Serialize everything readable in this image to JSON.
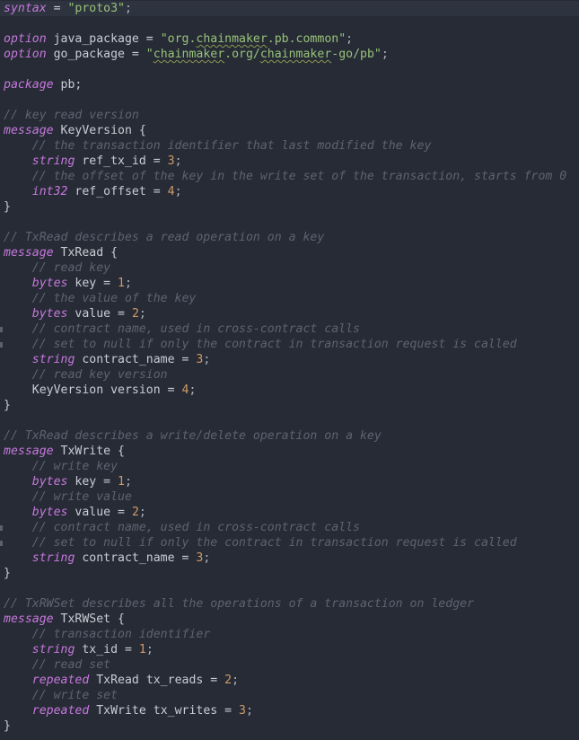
{
  "editor": {
    "language": "proto3",
    "lines": [
      {
        "y": 0,
        "tokens": [
          [
            "kw",
            "syntax"
          ],
          [
            "id",
            " = "
          ],
          [
            "str",
            "\"proto3\""
          ],
          [
            "punc",
            ";"
          ]
        ]
      },
      {
        "y": 1,
        "tokens": []
      },
      {
        "y": 2,
        "tokens": [
          [
            "kw",
            "option"
          ],
          [
            "id",
            " java_package = "
          ],
          [
            "str",
            "\"org."
          ],
          [
            "strw",
            "chainmaker"
          ],
          [
            "str",
            ".pb.common\""
          ],
          [
            "punc",
            ";"
          ]
        ]
      },
      {
        "y": 3,
        "tokens": [
          [
            "kw",
            "option"
          ],
          [
            "id",
            " go_package = "
          ],
          [
            "str",
            "\""
          ],
          [
            "strw",
            "chainmaker"
          ],
          [
            "str",
            ".org/"
          ],
          [
            "strw",
            "chainmaker"
          ],
          [
            "str",
            "-go/pb\""
          ],
          [
            "punc",
            ";"
          ]
        ]
      },
      {
        "y": 4,
        "tokens": []
      },
      {
        "y": 5,
        "tokens": [
          [
            "kw",
            "package"
          ],
          [
            "id",
            " pb;"
          ]
        ]
      },
      {
        "y": 6,
        "tokens": []
      },
      {
        "y": 7,
        "tokens": [
          [
            "cm",
            "// key read version"
          ]
        ]
      },
      {
        "y": 8,
        "tokens": [
          [
            "kw",
            "message"
          ],
          [
            "id",
            " KeyVersion {"
          ]
        ]
      },
      {
        "y": 9,
        "tokens": [
          [
            "id",
            "    "
          ],
          [
            "cm",
            "// the transaction identifier that last modified the key"
          ]
        ]
      },
      {
        "y": 10,
        "tokens": [
          [
            "id",
            "    "
          ],
          [
            "type",
            "string"
          ],
          [
            "id",
            " ref_tx_id = "
          ],
          [
            "num",
            "3"
          ],
          [
            "punc",
            ";"
          ]
        ]
      },
      {
        "y": 11,
        "tokens": [
          [
            "id",
            "    "
          ],
          [
            "cm",
            "// the offset of the key in the write set of the transaction, starts from 0"
          ]
        ]
      },
      {
        "y": 12,
        "tokens": [
          [
            "id",
            "    "
          ],
          [
            "type",
            "int32"
          ],
          [
            "id",
            " ref_offset = "
          ],
          [
            "num",
            "4"
          ],
          [
            "punc",
            ";"
          ]
        ]
      },
      {
        "y": 13,
        "tokens": [
          [
            "id",
            "}"
          ]
        ]
      },
      {
        "y": 14,
        "tokens": []
      },
      {
        "y": 15,
        "tokens": [
          [
            "cm",
            "// TxRead describes a read operation on a key"
          ]
        ]
      },
      {
        "y": 16,
        "tokens": [
          [
            "kw",
            "message"
          ],
          [
            "id",
            " TxRead {"
          ]
        ]
      },
      {
        "y": 17,
        "tokens": [
          [
            "id",
            "    "
          ],
          [
            "cm",
            "// read key"
          ]
        ]
      },
      {
        "y": 18,
        "tokens": [
          [
            "id",
            "    "
          ],
          [
            "type",
            "bytes"
          ],
          [
            "id",
            " key = "
          ],
          [
            "num",
            "1"
          ],
          [
            "punc",
            ";"
          ]
        ]
      },
      {
        "y": 19,
        "tokens": [
          [
            "id",
            "    "
          ],
          [
            "cm",
            "// the value of the key"
          ]
        ]
      },
      {
        "y": 20,
        "tokens": [
          [
            "id",
            "    "
          ],
          [
            "type",
            "bytes"
          ],
          [
            "id",
            " value = "
          ],
          [
            "num",
            "2"
          ],
          [
            "punc",
            ";"
          ]
        ]
      },
      {
        "y": 21,
        "tokens": [
          [
            "id",
            "    "
          ],
          [
            "cm",
            "// contract name, used in cross-contract calls"
          ]
        ],
        "mark": true
      },
      {
        "y": 22,
        "tokens": [
          [
            "id",
            "    "
          ],
          [
            "cm",
            "// set to null if only the contract in transaction request is called"
          ]
        ],
        "mark": true
      },
      {
        "y": 23,
        "tokens": [
          [
            "id",
            "    "
          ],
          [
            "type",
            "string"
          ],
          [
            "id",
            " contract_name = "
          ],
          [
            "num",
            "3"
          ],
          [
            "punc",
            ";"
          ]
        ]
      },
      {
        "y": 24,
        "tokens": [
          [
            "id",
            "    "
          ],
          [
            "cm",
            "// read key version"
          ]
        ]
      },
      {
        "y": 25,
        "tokens": [
          [
            "id",
            "    KeyVersion version = "
          ],
          [
            "num",
            "4"
          ],
          [
            "punc",
            ";"
          ]
        ]
      },
      {
        "y": 26,
        "tokens": [
          [
            "id",
            "}"
          ]
        ]
      },
      {
        "y": 27,
        "tokens": []
      },
      {
        "y": 28,
        "tokens": [
          [
            "cm",
            "// TxRead describes a write/delete operation on a key"
          ]
        ]
      },
      {
        "y": 29,
        "tokens": [
          [
            "kw",
            "message"
          ],
          [
            "id",
            " TxWrite {"
          ]
        ]
      },
      {
        "y": 30,
        "tokens": [
          [
            "id",
            "    "
          ],
          [
            "cm",
            "// write key"
          ]
        ]
      },
      {
        "y": 31,
        "tokens": [
          [
            "id",
            "    "
          ],
          [
            "type",
            "bytes"
          ],
          [
            "id",
            " key = "
          ],
          [
            "num",
            "1"
          ],
          [
            "punc",
            ";"
          ]
        ]
      },
      {
        "y": 32,
        "tokens": [
          [
            "id",
            "    "
          ],
          [
            "cm",
            "// write value"
          ]
        ]
      },
      {
        "y": 33,
        "tokens": [
          [
            "id",
            "    "
          ],
          [
            "type",
            "bytes"
          ],
          [
            "id",
            " value = "
          ],
          [
            "num",
            "2"
          ],
          [
            "punc",
            ";"
          ]
        ]
      },
      {
        "y": 34,
        "tokens": [
          [
            "id",
            "    "
          ],
          [
            "cm",
            "// contract name, used in cross-contract calls"
          ]
        ],
        "mark": true
      },
      {
        "y": 35,
        "tokens": [
          [
            "id",
            "    "
          ],
          [
            "cm",
            "// set to null if only the contract in transaction request is called"
          ]
        ],
        "mark": true
      },
      {
        "y": 36,
        "tokens": [
          [
            "id",
            "    "
          ],
          [
            "type",
            "string"
          ],
          [
            "id",
            " contract_name = "
          ],
          [
            "num",
            "3"
          ],
          [
            "punc",
            ";"
          ]
        ]
      },
      {
        "y": 37,
        "tokens": [
          [
            "id",
            "}"
          ]
        ]
      },
      {
        "y": 38,
        "tokens": []
      },
      {
        "y": 39,
        "tokens": [
          [
            "cm",
            "// TxRWSet describes all the operations of a transaction on ledger"
          ]
        ]
      },
      {
        "y": 40,
        "tokens": [
          [
            "kw",
            "message"
          ],
          [
            "id",
            " TxRWSet {"
          ]
        ]
      },
      {
        "y": 41,
        "tokens": [
          [
            "id",
            "    "
          ],
          [
            "cm",
            "// transaction identifier"
          ]
        ]
      },
      {
        "y": 42,
        "tokens": [
          [
            "id",
            "    "
          ],
          [
            "type",
            "string"
          ],
          [
            "id",
            " tx_id = "
          ],
          [
            "num",
            "1"
          ],
          [
            "punc",
            ";"
          ]
        ]
      },
      {
        "y": 43,
        "tokens": [
          [
            "id",
            "    "
          ],
          [
            "cm",
            "// read set"
          ]
        ]
      },
      {
        "y": 44,
        "tokens": [
          [
            "id",
            "    "
          ],
          [
            "type",
            "repeated"
          ],
          [
            "id",
            " TxRead tx_reads = "
          ],
          [
            "num",
            "2"
          ],
          [
            "punc",
            ";"
          ]
        ]
      },
      {
        "y": 45,
        "tokens": [
          [
            "id",
            "    "
          ],
          [
            "cm",
            "// write set"
          ]
        ]
      },
      {
        "y": 46,
        "tokens": [
          [
            "id",
            "    "
          ],
          [
            "type",
            "repeated"
          ],
          [
            "id",
            " TxWrite tx_writes = "
          ],
          [
            "num",
            "3"
          ],
          [
            "punc",
            ";"
          ]
        ]
      },
      {
        "y": 47,
        "tokens": [
          [
            "id",
            "}"
          ]
        ]
      }
    ]
  }
}
